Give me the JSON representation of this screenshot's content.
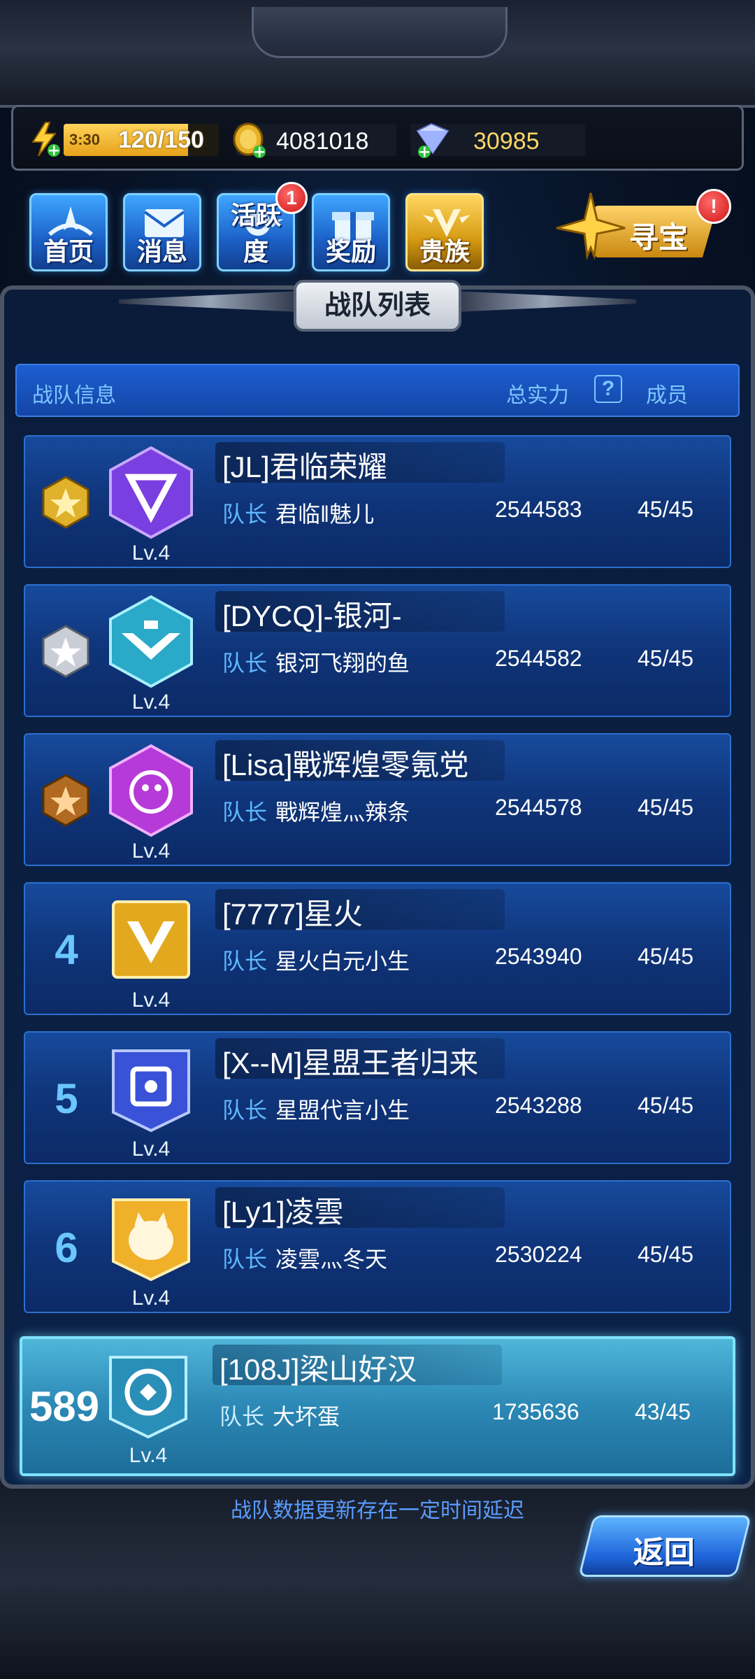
{
  "resources": {
    "energy_timer": "3:30",
    "energy_value": "120/150",
    "energy_fraction": 0.8,
    "coins": "4081018",
    "gems": "30985"
  },
  "nav": {
    "home": "首页",
    "messages": "消息",
    "activity": "活跃度",
    "activity_badge": "1",
    "rewards": "奖励",
    "nobility": "贵族",
    "treasure": "寻宝",
    "treasure_badge": "!"
  },
  "panel": {
    "title": "战队列表",
    "header_info": "战队信息",
    "header_power": "总实力",
    "header_help": "?",
    "header_members": "成员"
  },
  "teams": [
    {
      "rank": "",
      "medal": "gold-medal-icon",
      "name": "[JL]君临荣耀",
      "captain_label": "队长",
      "captain": "君临‖魅儿",
      "power": "2544583",
      "members": "45/45",
      "level": "Lv.4"
    },
    {
      "rank": "",
      "medal": "silver-medal-icon",
      "name": "[DYCQ]-银河-",
      "captain_label": "队长",
      "captain": "银河飞翔的鱼",
      "power": "2544582",
      "members": "45/45",
      "level": "Lv.4"
    },
    {
      "rank": "",
      "medal": "bronze-medal-icon",
      "name": "[Lisa]戰辉煌零氪党",
      "captain_label": "队长",
      "captain": "戰辉煌灬辣条",
      "power": "2544578",
      "members": "45/45",
      "level": "Lv.4"
    },
    {
      "rank": "4",
      "name": "[7777]星火",
      "captain_label": "队长",
      "captain": "星火白元小生",
      "power": "2543940",
      "members": "45/45",
      "level": "Lv.4"
    },
    {
      "rank": "5",
      "name": "[X--M]星盟王者归来",
      "captain_label": "队长",
      "captain": "星盟代言小生",
      "power": "2543288",
      "members": "45/45",
      "level": "Lv.4"
    },
    {
      "rank": "6",
      "name": "[Ly1]凌雲",
      "captain_label": "队长",
      "captain": "凌雲灬冬天",
      "power": "2530224",
      "members": "45/45",
      "level": "Lv.4"
    }
  ],
  "my_team": {
    "rank": "589",
    "name": "[108J]梁山好汉",
    "captain_label": "队长",
    "captain": "大坏蛋",
    "power": "1735636",
    "members": "43/45",
    "level": "Lv.4"
  },
  "footer": {
    "note": "战队数据更新存在一定时间延迟",
    "back": "返回"
  },
  "colors": {
    "accent_blue": "#5fb7ff",
    "gold": "#ffd764",
    "badge_red": "#d01515"
  }
}
